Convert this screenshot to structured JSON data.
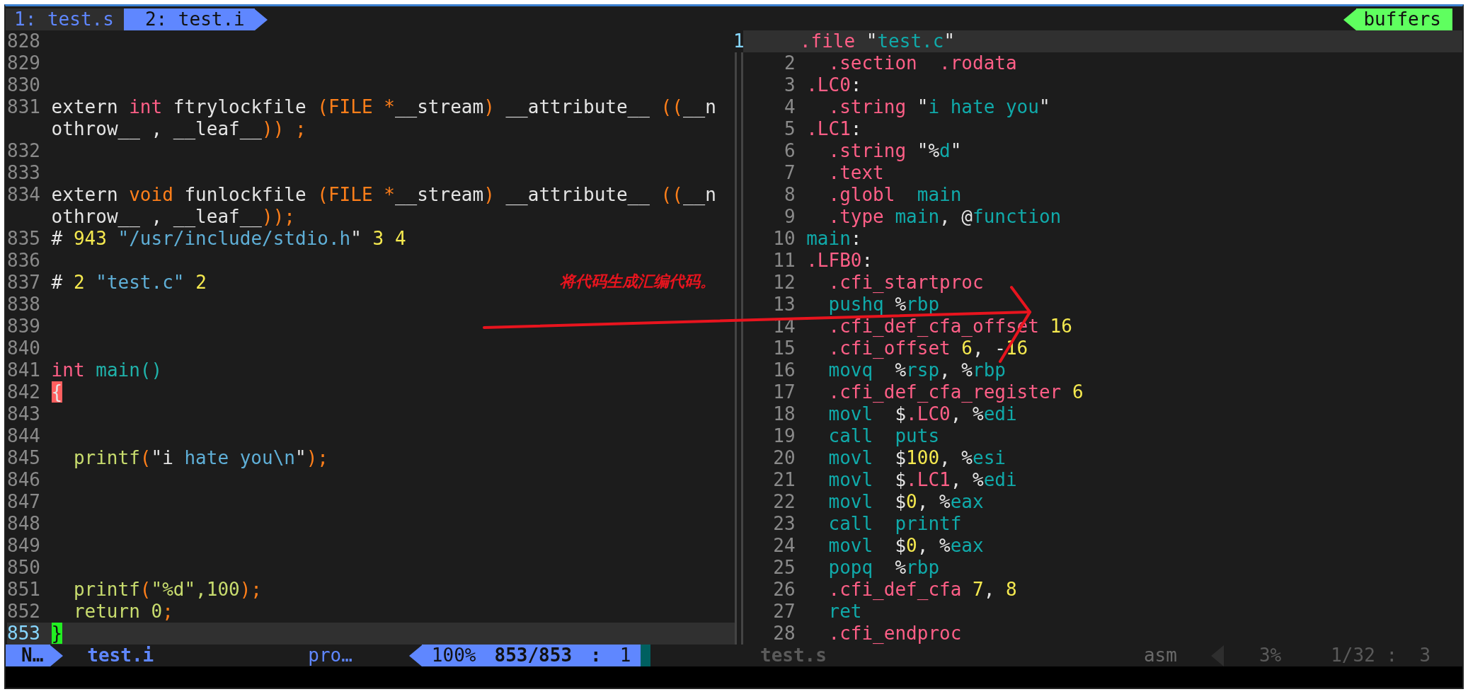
{
  "tabline": {
    "tabs": [
      {
        "label": "1: test.s",
        "selected": false
      },
      {
        "label": "2: test.i",
        "selected": true
      }
    ],
    "buffers_label": "buffers"
  },
  "left_pane": {
    "lines": [
      {
        "number": "828",
        "current": false
      },
      {
        "number": "829",
        "current": false
      },
      {
        "number": "830",
        "current": false
      },
      {
        "number": "831",
        "current": false,
        "indented": false,
        "segments": [
          {
            "text": "extern ",
            "kind": "plain"
          },
          {
            "text": "int",
            "kind": "kw"
          },
          {
            "text": " ftrylockfile ",
            "kind": "plain"
          },
          {
            "text": "(FILE *",
            "kind": "op"
          },
          {
            "text": "__stream",
            "kind": "plain"
          },
          {
            "text": ")",
            "kind": "op"
          },
          {
            "text": " __attribute__ ",
            "kind": "plain"
          },
          {
            "text": "((",
            "kind": "op"
          },
          {
            "text": "__n",
            "kind": "plain"
          }
        ],
        "wrap": [
          {
            "text": "othrow__ , __leaf__",
            "kind": "plain"
          },
          {
            "text": ")) ;",
            "kind": "op"
          }
        ]
      },
      {
        "number": "832",
        "current": false
      },
      {
        "number": "833",
        "current": false
      },
      {
        "number": "834",
        "current": false,
        "indented": false,
        "segments": [
          {
            "text": "extern ",
            "kind": "plain"
          },
          {
            "text": "void",
            "kind": "op"
          },
          {
            "text": " funlockfile ",
            "kind": "plain"
          },
          {
            "text": "(FILE *",
            "kind": "op"
          },
          {
            "text": "__stream",
            "kind": "plain"
          },
          {
            "text": ")",
            "kind": "op"
          },
          {
            "text": " __attribute__ ",
            "kind": "plain"
          },
          {
            "text": "((",
            "kind": "op"
          },
          {
            "text": "__n",
            "kind": "plain"
          }
        ],
        "wrap": [
          {
            "text": "othrow__ , __leaf__",
            "kind": "plain"
          },
          {
            "text": "));",
            "kind": "op"
          }
        ]
      },
      {
        "number": "835",
        "current": false,
        "indented": false,
        "segments": [
          {
            "text": "# ",
            "kind": "plain"
          },
          {
            "text": "943",
            "kind": "num"
          },
          {
            "text": " \"/usr/include/stdio.h",
            "kind": "str"
          },
          {
            "text": "\" ",
            "kind": "plain"
          },
          {
            "text": "3 4",
            "kind": "num"
          }
        ]
      },
      {
        "number": "836",
        "current": false
      },
      {
        "number": "837",
        "current": false,
        "indented": false,
        "segments": [
          {
            "text": "# ",
            "kind": "plain"
          },
          {
            "text": "2",
            "kind": "num"
          },
          {
            "text": " \"test.c\" ",
            "kind": "str"
          },
          {
            "text": "2",
            "kind": "num"
          }
        ]
      },
      {
        "number": "838",
        "current": false
      },
      {
        "number": "839",
        "current": false
      },
      {
        "number": "840",
        "current": false
      },
      {
        "number": "841",
        "current": false,
        "indented": false,
        "segments": [
          {
            "text": "int",
            "kind": "kw"
          },
          {
            "text": " main()",
            "kind": "func"
          }
        ]
      },
      {
        "number": "842",
        "current": false,
        "indented": false,
        "segments": [
          {
            "text": "{",
            "kind": "match"
          }
        ]
      },
      {
        "number": "843",
        "current": false
      },
      {
        "number": "844",
        "current": false
      },
      {
        "number": "845",
        "current": false,
        "indented": true,
        "segments": [
          {
            "text": "printf",
            "kind": "call"
          },
          {
            "text": "(",
            "kind": "op"
          },
          {
            "text": "\"i ",
            "kind": "plain"
          },
          {
            "text": "hate you\\n",
            "kind": "str"
          },
          {
            "text": "\"",
            "kind": "plain"
          },
          {
            "text": ");",
            "kind": "op"
          }
        ]
      },
      {
        "number": "846",
        "current": false
      },
      {
        "number": "847",
        "current": false
      },
      {
        "number": "848",
        "current": false
      },
      {
        "number": "849",
        "current": false
      },
      {
        "number": "850",
        "current": false
      },
      {
        "number": "851",
        "current": false,
        "indented": true,
        "segments": [
          {
            "text": "printf",
            "kind": "call"
          },
          {
            "text": "(",
            "kind": "op"
          },
          {
            "text": "\"%d\",100",
            "kind": "call"
          },
          {
            "text": ");",
            "kind": "op"
          }
        ]
      },
      {
        "number": "852",
        "current": false,
        "indented": true,
        "segments": [
          {
            "text": "return 0",
            "kind": "call"
          },
          {
            "text": ";",
            "kind": "op"
          }
        ]
      },
      {
        "number": "853",
        "current": true,
        "indented": false,
        "segments": [
          {
            "text": "}",
            "kind": "cursor"
          }
        ]
      }
    ]
  },
  "right_pane": {
    "lines": [
      {
        "number": "1",
        "current": true,
        "indented": false,
        "segments": [
          {
            "text": ".file ",
            "kind": "kw"
          },
          {
            "text": "\"",
            "kind": "plain"
          },
          {
            "text": "test.c",
            "kind": "ident"
          },
          {
            "text": "\"",
            "kind": "plain"
          }
        ]
      },
      {
        "number": "2",
        "current": false,
        "indented": true,
        "segments": [
          {
            "text": ".section  .rodata",
            "kind": "kw"
          }
        ]
      },
      {
        "number": "3",
        "current": false,
        "indented": false,
        "segments": [
          {
            "text": ".LC0",
            "kind": "kw"
          },
          {
            "text": ":",
            "kind": "plain"
          }
        ]
      },
      {
        "number": "4",
        "current": false,
        "indented": true,
        "segments": [
          {
            "text": ".string ",
            "kind": "kw"
          },
          {
            "text": "\"",
            "kind": "plain"
          },
          {
            "text": "i hate you",
            "kind": "ident"
          },
          {
            "text": "\"",
            "kind": "plain"
          }
        ]
      },
      {
        "number": "5",
        "current": false,
        "indented": false,
        "segments": [
          {
            "text": ".LC1",
            "kind": "kw"
          },
          {
            "text": ":",
            "kind": "plain"
          }
        ]
      },
      {
        "number": "6",
        "current": false,
        "indented": true,
        "segments": [
          {
            "text": ".string ",
            "kind": "kw"
          },
          {
            "text": "\"%",
            "kind": "plain"
          },
          {
            "text": "d",
            "kind": "ident"
          },
          {
            "text": "\"",
            "kind": "plain"
          }
        ]
      },
      {
        "number": "7",
        "current": false,
        "indented": true,
        "segments": [
          {
            "text": ".text",
            "kind": "kw"
          }
        ]
      },
      {
        "number": "8",
        "current": false,
        "indented": true,
        "segments": [
          {
            "text": ".globl  ",
            "kind": "kw"
          },
          {
            "text": "main",
            "kind": "ident"
          }
        ]
      },
      {
        "number": "9",
        "current": false,
        "indented": true,
        "segments": [
          {
            "text": ".type ",
            "kind": "kw"
          },
          {
            "text": "main",
            "kind": "ident"
          },
          {
            "text": ", @",
            "kind": "plain"
          },
          {
            "text": "function",
            "kind": "ident"
          }
        ]
      },
      {
        "number": "10",
        "current": false,
        "indented": false,
        "segments": [
          {
            "text": "main",
            "kind": "ident"
          },
          {
            "text": ":",
            "kind": "plain"
          }
        ]
      },
      {
        "number": "11",
        "current": false,
        "indented": false,
        "segments": [
          {
            "text": ".LFB0",
            "kind": "kw"
          },
          {
            "text": ":",
            "kind": "plain"
          }
        ]
      },
      {
        "number": "12",
        "current": false,
        "indented": true,
        "segments": [
          {
            "text": ".cfi_startproc",
            "kind": "kw"
          }
        ]
      },
      {
        "number": "13",
        "current": false,
        "indented": true,
        "segments": [
          {
            "text": "pushq ",
            "kind": "ident"
          },
          {
            "text": "%",
            "kind": "plain"
          },
          {
            "text": "rbp",
            "kind": "ident"
          }
        ]
      },
      {
        "number": "14",
        "current": false,
        "indented": true,
        "segments": [
          {
            "text": ".cfi_def_cfa_offset ",
            "kind": "kw"
          },
          {
            "text": "16",
            "kind": "num"
          }
        ]
      },
      {
        "number": "15",
        "current": false,
        "indented": true,
        "segments": [
          {
            "text": ".cfi_offset ",
            "kind": "kw"
          },
          {
            "text": "6",
            "kind": "num"
          },
          {
            "text": ", -",
            "kind": "plain"
          },
          {
            "text": "16",
            "kind": "num"
          }
        ]
      },
      {
        "number": "16",
        "current": false,
        "indented": true,
        "segments": [
          {
            "text": "movq  ",
            "kind": "ident"
          },
          {
            "text": "%",
            "kind": "plain"
          },
          {
            "text": "rsp",
            "kind": "ident"
          },
          {
            "text": ", %",
            "kind": "plain"
          },
          {
            "text": "rbp",
            "kind": "ident"
          }
        ]
      },
      {
        "number": "17",
        "current": false,
        "indented": true,
        "segments": [
          {
            "text": ".cfi_def_cfa_register ",
            "kind": "kw"
          },
          {
            "text": "6",
            "kind": "num"
          }
        ]
      },
      {
        "number": "18",
        "current": false,
        "indented": true,
        "segments": [
          {
            "text": "movl  ",
            "kind": "ident"
          },
          {
            "text": "$",
            "kind": "plain"
          },
          {
            "text": ".LC0",
            "kind": "kw"
          },
          {
            "text": ", %",
            "kind": "plain"
          },
          {
            "text": "edi",
            "kind": "ident"
          }
        ]
      },
      {
        "number": "19",
        "current": false,
        "indented": true,
        "segments": [
          {
            "text": "call  puts",
            "kind": "ident"
          }
        ]
      },
      {
        "number": "20",
        "current": false,
        "indented": true,
        "segments": [
          {
            "text": "movl  ",
            "kind": "ident"
          },
          {
            "text": "$",
            "kind": "plain"
          },
          {
            "text": "100",
            "kind": "num"
          },
          {
            "text": ", %",
            "kind": "plain"
          },
          {
            "text": "esi",
            "kind": "ident"
          }
        ]
      },
      {
        "number": "21",
        "current": false,
        "indented": true,
        "segments": [
          {
            "text": "movl  ",
            "kind": "ident"
          },
          {
            "text": "$",
            "kind": "plain"
          },
          {
            "text": ".LC1",
            "kind": "kw"
          },
          {
            "text": ", %",
            "kind": "plain"
          },
          {
            "text": "edi",
            "kind": "ident"
          }
        ]
      },
      {
        "number": "22",
        "current": false,
        "indented": true,
        "segments": [
          {
            "text": "movl  ",
            "kind": "ident"
          },
          {
            "text": "$",
            "kind": "plain"
          },
          {
            "text": "0",
            "kind": "num"
          },
          {
            "text": ", %",
            "kind": "plain"
          },
          {
            "text": "eax",
            "kind": "ident"
          }
        ]
      },
      {
        "number": "23",
        "current": false,
        "indented": true,
        "segments": [
          {
            "text": "call  printf",
            "kind": "ident"
          }
        ]
      },
      {
        "number": "24",
        "current": false,
        "indented": true,
        "segments": [
          {
            "text": "movl  ",
            "kind": "ident"
          },
          {
            "text": "$",
            "kind": "plain"
          },
          {
            "text": "0",
            "kind": "num"
          },
          {
            "text": ", %",
            "kind": "plain"
          },
          {
            "text": "eax",
            "kind": "ident"
          }
        ]
      },
      {
        "number": "25",
        "current": false,
        "indented": true,
        "segments": [
          {
            "text": "popq  ",
            "kind": "ident"
          },
          {
            "text": "%",
            "kind": "plain"
          },
          {
            "text": "rbp",
            "kind": "ident"
          }
        ]
      },
      {
        "number": "26",
        "current": false,
        "indented": true,
        "segments": [
          {
            "text": ".cfi_def_cfa ",
            "kind": "kw"
          },
          {
            "text": "7",
            "kind": "num"
          },
          {
            "text": ", ",
            "kind": "plain"
          },
          {
            "text": "8",
            "kind": "num"
          }
        ]
      },
      {
        "number": "27",
        "current": false,
        "indented": true,
        "segments": [
          {
            "text": "ret",
            "kind": "ident"
          }
        ]
      },
      {
        "number": "28",
        "current": false,
        "indented": true,
        "segments": [
          {
            "text": ".cfi_endproc",
            "kind": "kw"
          }
        ]
      }
    ]
  },
  "annotation": {
    "text": "将代码生成汇编代码。"
  },
  "status_left": {
    "mode": "N…",
    "file": "test.i",
    "filetype": "pro…",
    "percent": "100%",
    "position": "853/853",
    "separator": ":",
    "column": "1"
  },
  "status_right": {
    "file": "test.s",
    "filetype": "asm",
    "percent": "3%",
    "position": "1/32",
    "separator": ":",
    "column": "3"
  }
}
